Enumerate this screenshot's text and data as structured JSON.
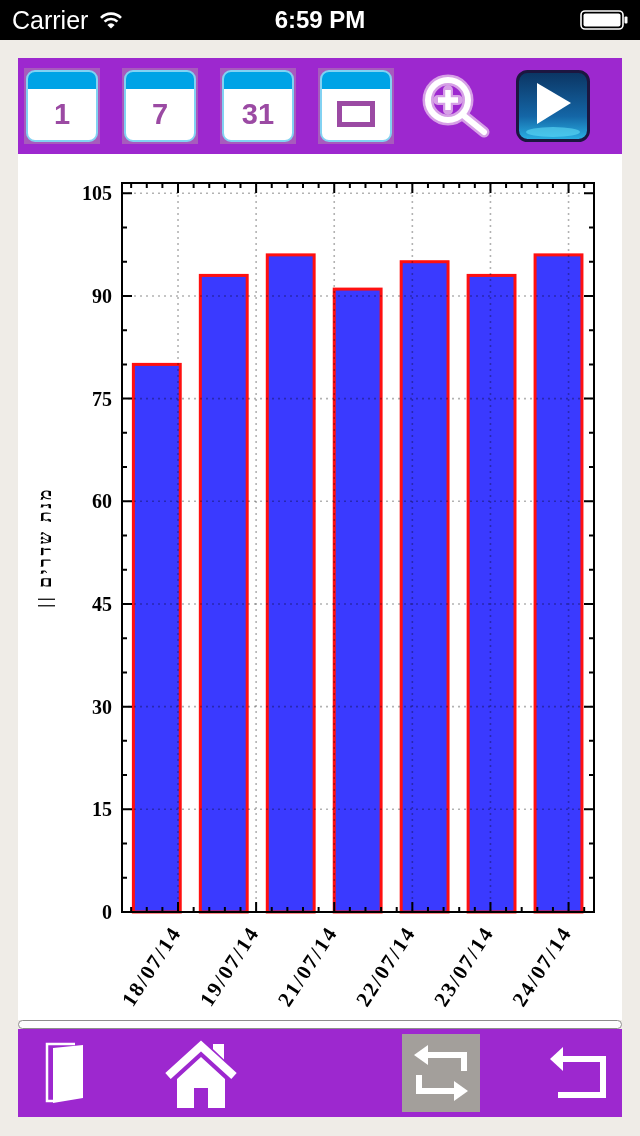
{
  "status_bar": {
    "carrier": "Carrier",
    "time": "6:59 PM"
  },
  "toolbar": {
    "range_buttons": [
      {
        "label": "1"
      },
      {
        "label": "7"
      },
      {
        "label": "31"
      }
    ]
  },
  "chart": {
    "chart_data": {
      "type": "bar",
      "ylabel": "מנת שדרים ||",
      "categories": [
        "18/07/14",
        "19/07/14",
        null,
        "21/07/14",
        "22/07/14",
        "23/07/14",
        "24/07/14"
      ],
      "series": [
        {
          "color": "#3a3aff",
          "values": [
            80,
            93,
            96,
            91,
            95,
            93,
            96
          ]
        }
      ],
      "ylim": [
        0,
        106.5
      ],
      "yticks": [
        0,
        15,
        30,
        45,
        60,
        75,
        90,
        105
      ],
      "grid": true
    }
  },
  "bottom_toolbar": {
    "buttons": [
      {
        "selected": false
      },
      {
        "selected": false
      },
      {
        "selected": true
      },
      {
        "selected": false
      }
    ]
  }
}
